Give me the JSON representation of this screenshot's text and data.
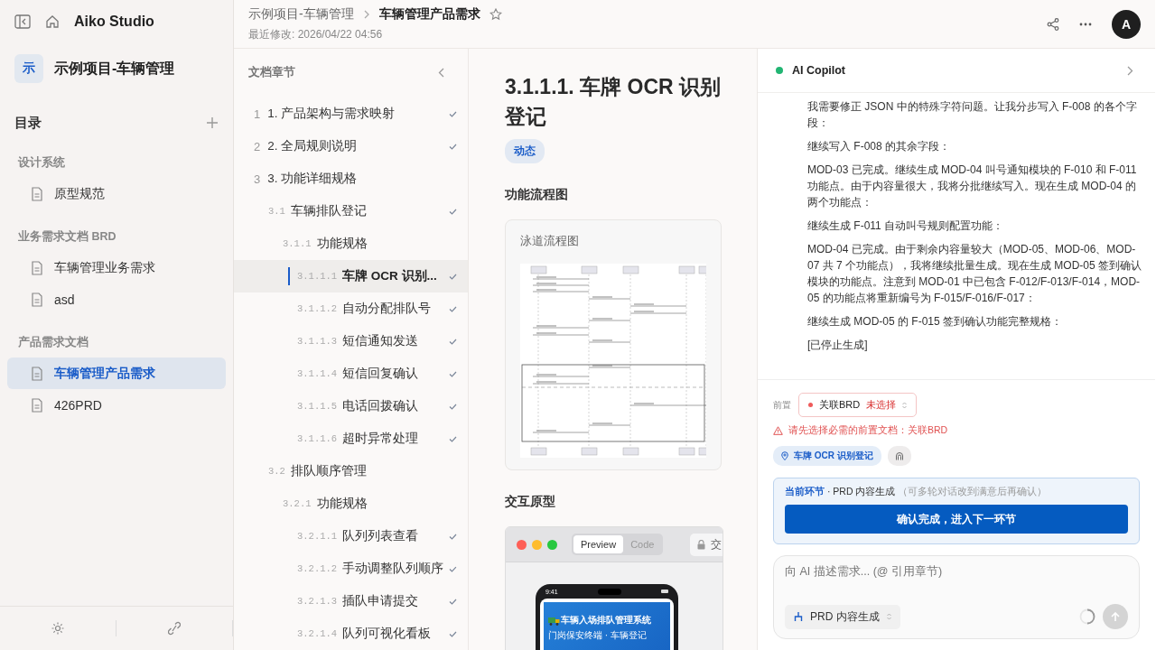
{
  "app": {
    "name": "Aiko Studio"
  },
  "project": {
    "initial": "示",
    "name": "示例项目-车辆管理"
  },
  "sidebar": {
    "title": "目录",
    "groups": [
      {
        "label": "设计系统",
        "items": [
          {
            "label": "原型规范",
            "selected": false
          }
        ]
      },
      {
        "label": "业务需求文档 BRD",
        "items": [
          {
            "label": "车辆管理业务需求",
            "selected": false
          },
          {
            "label": "asd",
            "selected": false
          }
        ]
      },
      {
        "label": "产品需求文档",
        "items": [
          {
            "label": "车辆管理产品需求",
            "selected": true
          },
          {
            "label": "426PRD",
            "selected": false
          }
        ]
      }
    ]
  },
  "header": {
    "breadcrumb": [
      "示例项目-车辆管理",
      "车辆管理产品需求"
    ],
    "modified": "最近修改: 2026/04/22 04:56",
    "starred": false,
    "avatar": "A"
  },
  "chapters": {
    "title": "文档章节",
    "items": [
      {
        "number": "1",
        "title": "1. 产品架构与需求映射",
        "done": true,
        "selected": false
      },
      {
        "number": "2",
        "title": "2. 全局规则说明",
        "done": true,
        "selected": false
      },
      {
        "number": "3",
        "title": "3. 功能详细规格",
        "done": false,
        "selected": false,
        "children": [
          {
            "number": "3.1",
            "title": "车辆排队登记",
            "done": true,
            "selected": false,
            "children": [
              {
                "number": "3.1.1",
                "title": "功能规格",
                "done": false,
                "selected": false,
                "children": [
                  {
                    "number": "3.1.1.1",
                    "title": "车牌 OCR 识别...",
                    "done": true,
                    "selected": true
                  },
                  {
                    "number": "3.1.1.2",
                    "title": "自动分配排队号",
                    "done": true,
                    "selected": false
                  },
                  {
                    "number": "3.1.1.3",
                    "title": "短信通知发送",
                    "done": true,
                    "selected": false
                  },
                  {
                    "number": "3.1.1.4",
                    "title": "短信回复确认",
                    "done": true,
                    "selected": false
                  },
                  {
                    "number": "3.1.1.5",
                    "title": "电话回拨确认",
                    "done": true,
                    "selected": false
                  },
                  {
                    "number": "3.1.1.6",
                    "title": "超时异常处理",
                    "done": true,
                    "selected": false
                  }
                ]
              }
            ]
          },
          {
            "number": "3.2",
            "title": "排队顺序管理",
            "done": false,
            "selected": false,
            "children": [
              {
                "number": "3.2.1",
                "title": "功能规格",
                "done": false,
                "selected": false,
                "children": [
                  {
                    "number": "3.2.1.1",
                    "title": "队列列表查看",
                    "done": true,
                    "selected": false
                  },
                  {
                    "number": "3.2.1.2",
                    "title": "手动调整队列顺序",
                    "done": true,
                    "selected": false
                  },
                  {
                    "number": "3.2.1.3",
                    "title": "插队申请提交",
                    "done": true,
                    "selected": false
                  },
                  {
                    "number": "3.2.1.4",
                    "title": "队列可视化看板",
                    "done": true,
                    "selected": false
                  }
                ]
              }
            ]
          }
        ]
      }
    ]
  },
  "document": {
    "title": "3.1.1.1. 车牌 OCR 识别登记",
    "tag": "动态",
    "sections": [
      {
        "kind": "diagram",
        "heading": "功能流程图",
        "caption": "泳道流程图"
      },
      {
        "kind": "prototype",
        "heading": "交互原型",
        "tabs": [
          {
            "label": "Preview",
            "selected": true
          },
          {
            "label": "Code",
            "selected": false
          }
        ],
        "address": "交",
        "phone_time": "9:41",
        "app_title": "车辆入场排队管理系统",
        "app_subtitle": "门岗保安终端 · 车辆登记"
      }
    ]
  },
  "copilot": {
    "title": "AI Copilot",
    "online": true,
    "messages": [
      "我需要修正 JSON 中的特殊字符问题。让我分步写入 F-008 的各个字段：",
      "继续写入 F-008 的其余字段：",
      "MOD-03 已完成。继续生成 MOD-04 叫号通知模块的 F-010 和 F-011 功能点。由于内容量很大，我将分批继续写入。现在生成 MOD-04 的两个功能点：",
      "继续生成 F-011 自动叫号规则配置功能：",
      "MOD-04 已完成。由于剩余内容量较大（MOD-05、MOD-06、MOD-07 共 7 个功能点），我将继续批量生成。现在生成 MOD-05 签到确认模块的功能点。注意到 MOD-01 中已包含 F-012/F-013/F-014，MOD-05 的功能点将重新编号为 F-015/F-016/F-017：",
      "继续生成 MOD-05 的 F-015 签到确认功能完整规格：",
      "[已停止生成]"
    ],
    "prereq": {
      "label": "前置",
      "name": "关联BRD",
      "value": "未选择"
    },
    "warning": "请先选择必需的前置文档：关联BRD",
    "context_chip": "车牌 OCR 识别登记",
    "stage": {
      "label": "当前环节",
      "name": "· PRD 内容生成",
      "hint": "（可多轮对话改到满意后再确认）",
      "button": "确认完成，进入下一环节"
    },
    "composer": {
      "placeholder": "向 AI 描述需求... (@ 引用章节)",
      "mode": "PRD 内容生成"
    }
  }
}
